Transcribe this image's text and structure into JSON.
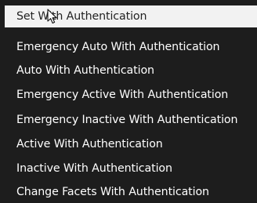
{
  "menu": {
    "items": [
      {
        "label": "Set With Authentication",
        "selected": true
      },
      {
        "label": "Emergency Auto With Authentication"
      },
      {
        "label": "Auto With Authentication"
      },
      {
        "label": "Emergency Active With Authentication"
      },
      {
        "label": "Emergency Inactive With Authentication"
      },
      {
        "label": "Active With Authentication"
      },
      {
        "label": "Inactive With Authentication"
      },
      {
        "label": "Change Facets With Authentication"
      }
    ]
  },
  "colors": {
    "menu_background": "#1d1d1d",
    "selected_background": "#f2f2f2",
    "text": "#ffffff",
    "selected_text": "#222222"
  },
  "icons": {
    "cursor": "mouse-pointer-icon"
  }
}
